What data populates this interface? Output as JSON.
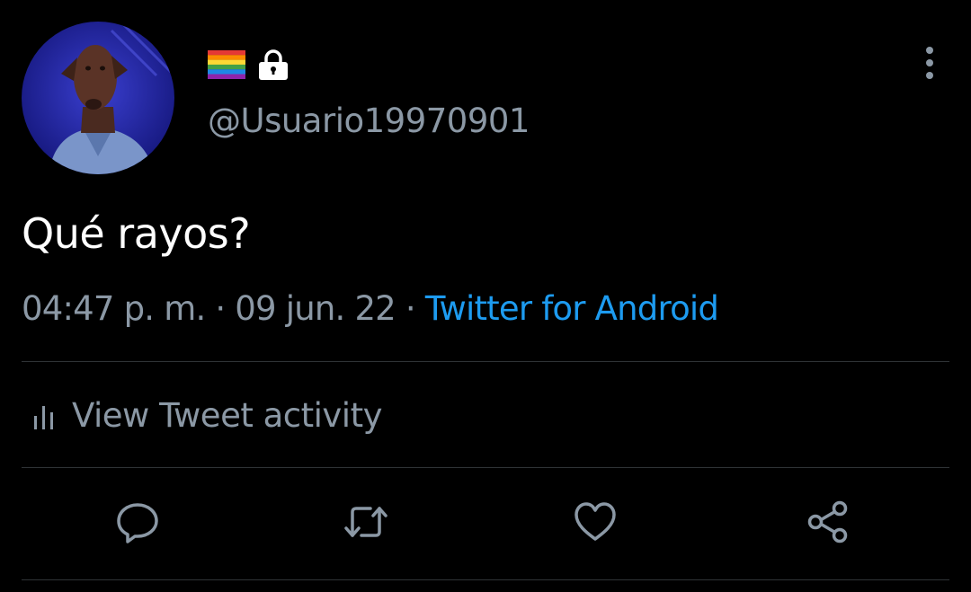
{
  "tweet": {
    "handle": "@Usuario19970901",
    "text": "Qué rayos?",
    "time": "04:47 p. m.",
    "separator": " · ",
    "date": "09 jun. 22",
    "source": "Twitter for Android"
  },
  "activity": {
    "label": "View Tweet activity"
  },
  "icons": {
    "name_row": [
      "rainbow-flag-icon",
      "lock-icon"
    ],
    "more": "more-vertical-icon",
    "activity": "bar-chart-icon",
    "actions": [
      "reply-icon",
      "retweet-icon",
      "like-icon",
      "share-icon"
    ]
  },
  "colors": {
    "background": "#000000",
    "text": "#ffffff",
    "secondary_text": "#8b98a5",
    "link": "#1d9bf0",
    "divider": "#2f3336"
  }
}
